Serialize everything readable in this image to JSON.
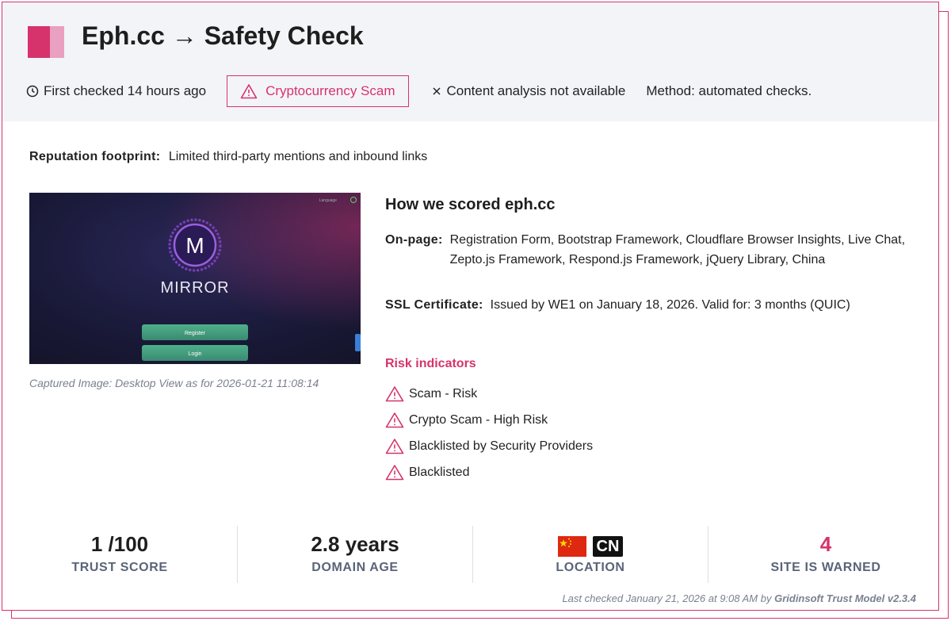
{
  "header": {
    "title": "Eph.cc → Safety Check",
    "first_checked": "First checked 14 hours ago",
    "badge": "Cryptocurrency Scam",
    "content_analysis": "Content analysis not available",
    "method": "Method: automated checks."
  },
  "reputation": {
    "label": "Reputation footprint:",
    "value": "Limited third-party mentions and inbound links"
  },
  "screenshot": {
    "language_label": "Language",
    "logo_letter": "M",
    "brand": "MIRROR",
    "register": "Register",
    "login": "Login",
    "caption": "Captured Image: Desktop View as for 2026-01-21 11:08:14"
  },
  "scoring": {
    "heading": "How we scored eph.cc",
    "onpage_label": "On-page:",
    "onpage_value": "Registration Form, Bootstrap Framework, Cloudflare Browser Insights, Live Chat, Zepto.js Framework, Respond.js Framework, jQuery Library, China",
    "ssl_label": "SSL Certificate:",
    "ssl_value": "Issued by WE1 on January 18, 2026. Valid for: 3 months (QUIC)"
  },
  "risk": {
    "title": "Risk indicators",
    "items": [
      "Scam - Risk",
      "Crypto Scam - High Risk",
      "Blacklisted by Security Providers",
      "Blacklisted"
    ]
  },
  "stats": {
    "trust_value": "1 /100",
    "trust_label": "TRUST SCORE",
    "age_value": "2.8 years",
    "age_label": "DOMAIN AGE",
    "location_code": "CN",
    "location_label": "LOCATION",
    "warned_value": "4",
    "warned_label": "SITE IS WARNED"
  },
  "footer": {
    "prefix": "Last checked January 21, 2026 at 9:08 AM by ",
    "model": "Gridinsoft Trust Model v2.3.4"
  },
  "colors": {
    "accent": "#d6336c",
    "header_bg": "#f3f4f8",
    "label_gray": "#5a6478"
  }
}
